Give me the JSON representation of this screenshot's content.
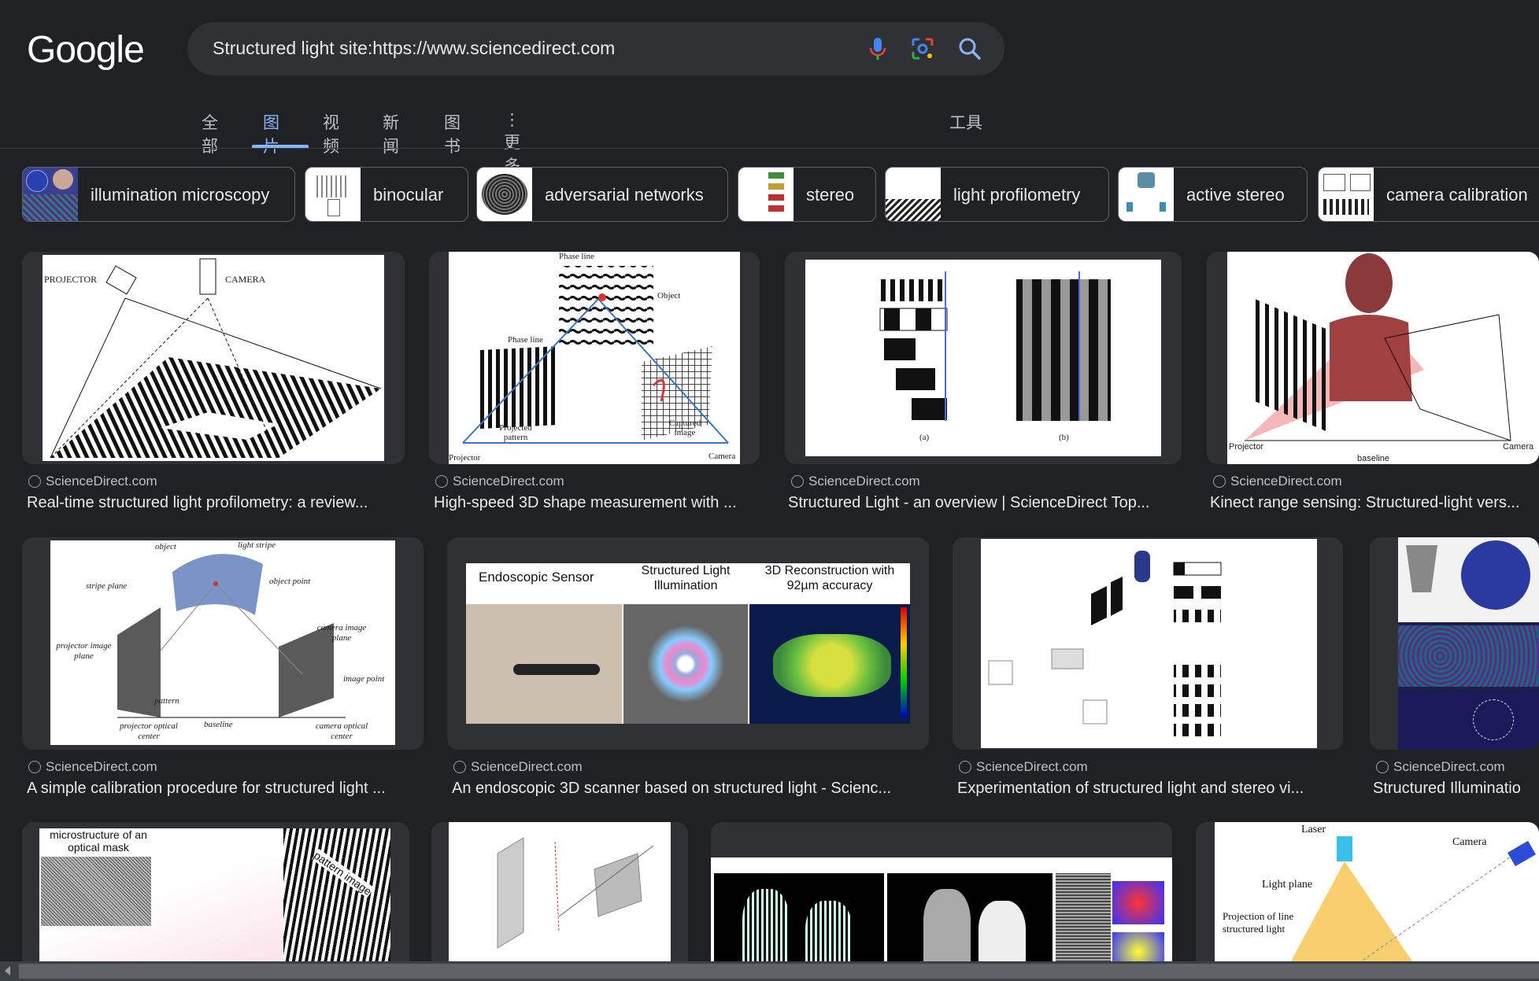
{
  "logo": "Google",
  "search": {
    "query": "Structured light site:https://www.sciencedirect.com"
  },
  "tabs": [
    {
      "label": "全部"
    },
    {
      "label": "图片"
    },
    {
      "label": "视频"
    },
    {
      "label": "新闻"
    },
    {
      "label": "图书"
    },
    {
      "label": "⋮ 更多"
    }
  ],
  "tools": "工具",
  "chips": [
    {
      "label": "illumination microscopy"
    },
    {
      "label": "binocular"
    },
    {
      "label": "adversarial networks"
    },
    {
      "label": "stereo"
    },
    {
      "label": "light profilometry"
    },
    {
      "label": "active stereo"
    },
    {
      "label": "camera calibration"
    }
  ],
  "results": [
    {
      "source": "ScienceDirect.com",
      "title": "Real-time structured light profilometry: a review..."
    },
    {
      "source": "ScienceDirect.com",
      "title": "High-speed 3D shape measurement with ..."
    },
    {
      "source": "ScienceDirect.com",
      "title": "Structured Light - an overview | ScienceDirect Top..."
    },
    {
      "source": "ScienceDirect.com",
      "title": "Kinect range sensing: Structured-light vers..."
    },
    {
      "source": "ScienceDirect.com",
      "title": "A simple calibration procedure for structured light ..."
    },
    {
      "source": "ScienceDirect.com",
      "title": "An endoscopic 3D scanner based on structured light - Scienc..."
    },
    {
      "source": "ScienceDirect.com",
      "title": "Experimentation of structured light and stereo vi..."
    },
    {
      "source": "ScienceDirect.com",
      "title": "Structured Illuminatio"
    }
  ],
  "image_text": {
    "r1c1": {
      "projector": "PROJECTOR",
      "camera": "CAMERA"
    },
    "r1c2": {
      "phase_line": "Phase line",
      "object": "Object",
      "phase_line2": "Phase line",
      "projected": "Projected pattern",
      "captured": "Captured image",
      "projector": "Projector",
      "camera": "Camera"
    },
    "r1c3": {
      "a": "(a)",
      "b": "(b)"
    },
    "r1c4": {
      "projector": "Projector",
      "camera": "Camera",
      "baseline": "baseline"
    },
    "r2c1": {
      "object": "object",
      "light_stripe": "light stripe",
      "stripe_plane": "stripe plane",
      "object_point": "object point",
      "projector_image_plane": "projector image plane",
      "camera_image_plane": "camera image plane",
      "image_point": "image point",
      "pattern": "pattern",
      "baseline": "baseline",
      "projector_optical_center": "projector optical center",
      "camera_optical_center": "camera optical center"
    },
    "r2c2": {
      "h1": "Endoscopic Sensor",
      "h2": "Structured Light Illumination",
      "h3": "3D Reconstruction with 92µm accuracy"
    },
    "r3c1": {
      "mask": "microstructure of an optical mask",
      "pattern": "pattern image"
    },
    "r3c4": {
      "laser": "Laser",
      "camera": "Camera",
      "light_plane": "Light plane",
      "projection": "Projection of line structured light"
    }
  }
}
